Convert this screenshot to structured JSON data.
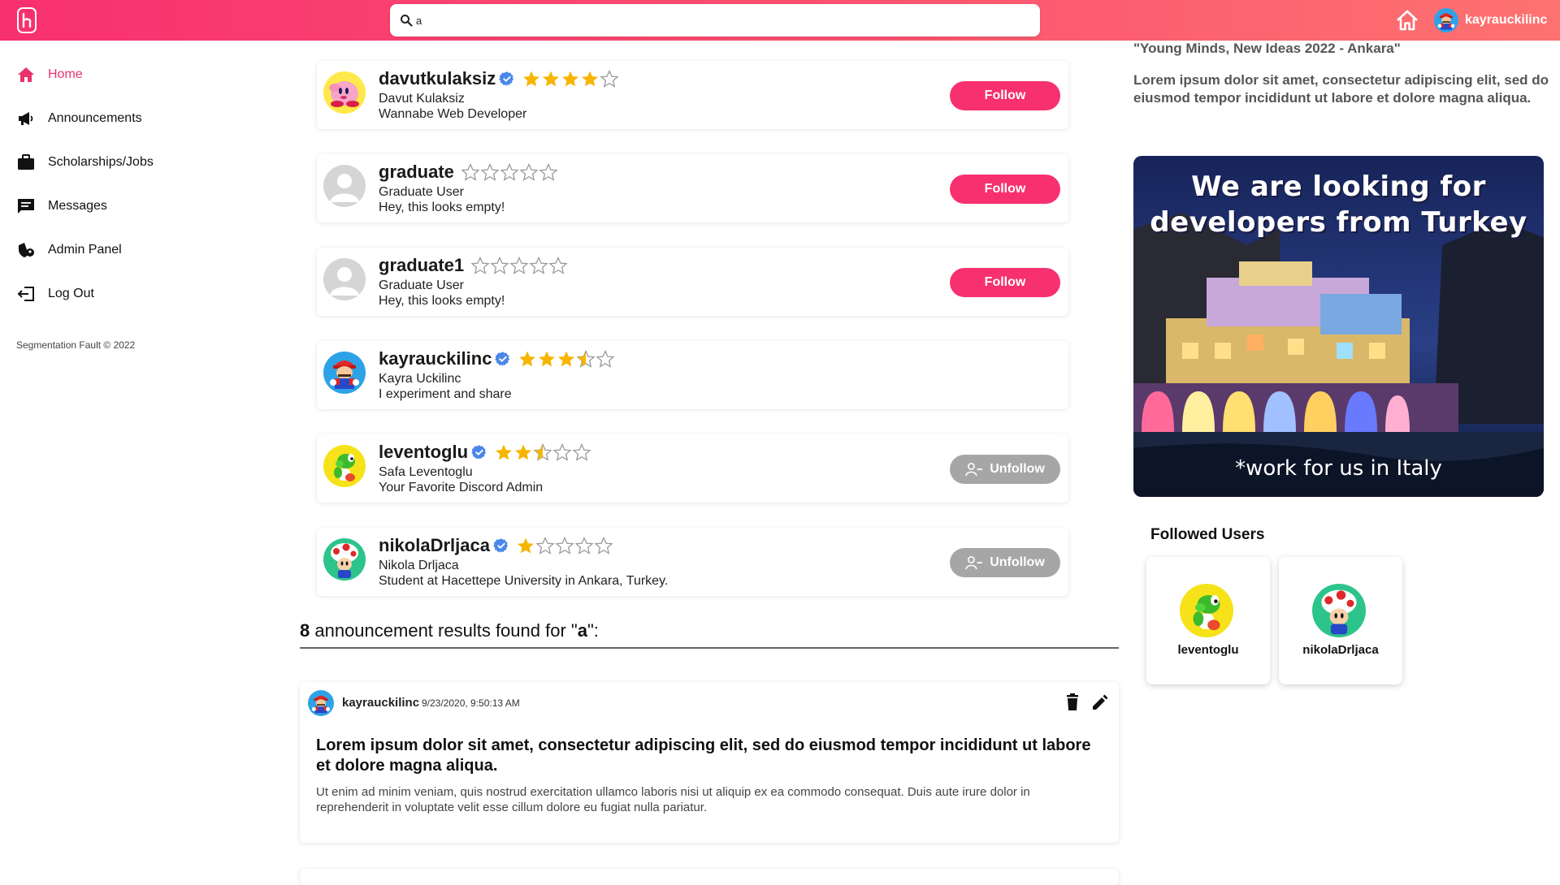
{
  "colors": {
    "accent": "#f7306f",
    "star": "#f7b500",
    "verified": "#4a87e8",
    "unfollow": "#a6a6a6"
  },
  "search": {
    "value": "a",
    "icon": "search-icon"
  },
  "topbar": {
    "username": "kayrauckilinc"
  },
  "sidebar": {
    "items": [
      {
        "label": "Home",
        "icon": "home-icon",
        "active": true
      },
      {
        "label": "Announcements",
        "icon": "megaphone-icon"
      },
      {
        "label": "Scholarships/Jobs",
        "icon": "briefcase-icon"
      },
      {
        "label": "Messages",
        "icon": "chat-icon"
      },
      {
        "label": "Admin Panel",
        "icon": "admin-shield-icon"
      },
      {
        "label": "Log Out",
        "icon": "logout-icon"
      }
    ],
    "copyright": "Segmentation Fault © 2022"
  },
  "users": [
    {
      "username": "davutkulaksiz",
      "verified": true,
      "rating": 4,
      "full_name": "Davut Kulaksiz",
      "bio": "Wannabe Web Developer",
      "action": "Follow",
      "avatar": "kirby"
    },
    {
      "username": "graduate",
      "verified": false,
      "rating": 0,
      "full_name": "Graduate User",
      "bio": "Hey, this looks empty!",
      "action": "Follow",
      "avatar": "default"
    },
    {
      "username": "graduate1",
      "verified": false,
      "rating": 0,
      "full_name": "Graduate User",
      "bio": "Hey, this looks empty!",
      "action": "Follow",
      "avatar": "default"
    },
    {
      "username": "kayrauckilinc",
      "verified": true,
      "rating": 3.5,
      "full_name": "Kayra Uckilinc",
      "bio": "I experiment and share",
      "action": "",
      "avatar": "mario"
    },
    {
      "username": "leventoglu",
      "verified": true,
      "rating": 2.5,
      "full_name": "Safa Leventoglu",
      "bio": "Your Favorite Discord Admin",
      "action": "Unfollow",
      "avatar": "yoshi"
    },
    {
      "username": "nikolaDrljaca",
      "verified": true,
      "rating": 1,
      "full_name": "Nikola Drljaca",
      "bio": "Student at Hacettepe University in Ankara, Turkey.",
      "action": "Unfollow",
      "avatar": "toad"
    }
  ],
  "results": {
    "count": "8",
    "middle": " announcement results found for \"",
    "query": "a",
    "end": "\":"
  },
  "announcement": {
    "username": "kayrauckilinc",
    "time": "9/23/2020, 9:50:13 AM",
    "title": "Lorem ipsum dolor sit amet, consectetur adipiscing elit, sed do eiusmod tempor incididunt ut labore et dolore magna aliqua.",
    "body": "Ut enim ad minim veniam, quis nostrud exercitation ullamco laboris nisi ut aliquip ex ea commodo consequat. Duis aute irure dolor in reprehenderit in voluptate velit esse cillum dolore eu fugiat nulla pariatur."
  },
  "right": {
    "event_title": "\"Young Minds, New Ideas 2022 - Ankara\"",
    "event_text": "Lorem ipsum dolor sit amet, consectetur adipiscing elit, sed do eiusmod tempor incididunt ut labore et dolore magna aliqua.",
    "banner_line1": "We are looking for",
    "banner_line2": "developers from Turkey",
    "banner_sub": "*work for us in Italy",
    "followed_title": "Followed Users",
    "followed": [
      {
        "username": "leventoglu",
        "avatar": "yoshi"
      },
      {
        "username": "nikolaDrljaca",
        "avatar": "toad"
      }
    ]
  }
}
